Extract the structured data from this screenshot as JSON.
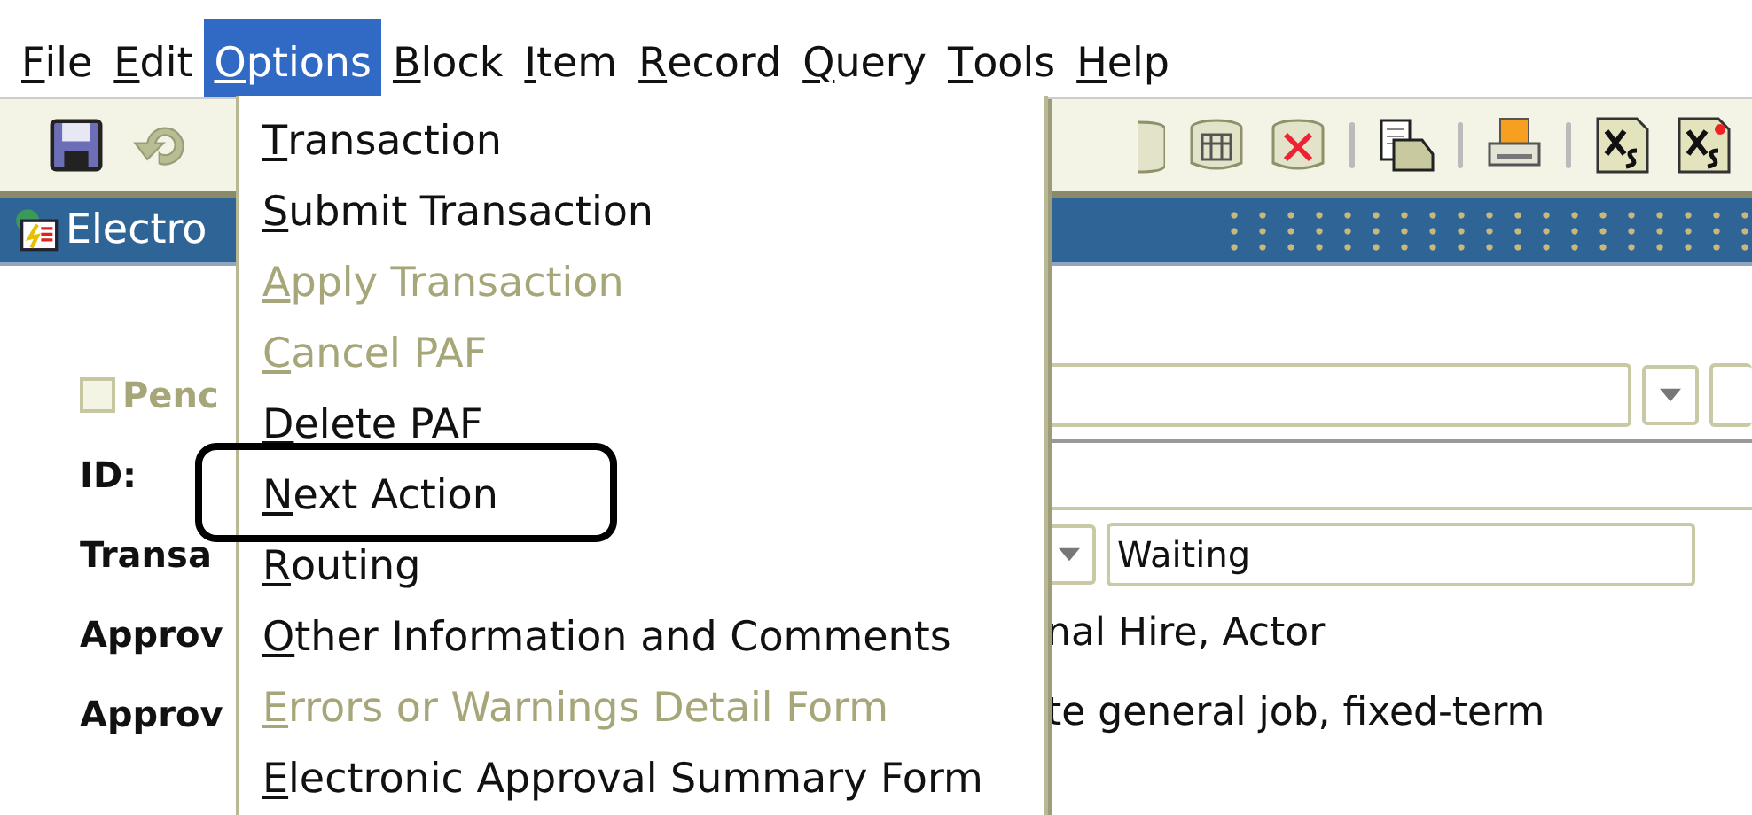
{
  "menu_bar": [
    {
      "label": "File",
      "selected": false
    },
    {
      "label": "Edit",
      "selected": false
    },
    {
      "label": "Options",
      "selected": true
    },
    {
      "label": "Block",
      "selected": false
    },
    {
      "label": "Item",
      "selected": false
    },
    {
      "label": "Record",
      "selected": false
    },
    {
      "label": "Query",
      "selected": false
    },
    {
      "label": "Tools",
      "selected": false
    },
    {
      "label": "Help",
      "selected": false
    }
  ],
  "title_bar": {
    "title": "Electro"
  },
  "options_menu": [
    {
      "label": "Transaction",
      "disabled": false,
      "outlined": false
    },
    {
      "label": "Submit Transaction",
      "disabled": false,
      "outlined": false
    },
    {
      "label": "Apply Transaction",
      "disabled": true,
      "outlined": false
    },
    {
      "label": "Cancel PAF",
      "disabled": true,
      "outlined": false
    },
    {
      "label": "Delete PAF",
      "disabled": false,
      "outlined": false
    },
    {
      "label": "Next Action",
      "disabled": false,
      "outlined": true
    },
    {
      "label": "Routing",
      "disabled": false,
      "outlined": false
    },
    {
      "label": "Other Information and Comments",
      "disabled": false,
      "outlined": false
    },
    {
      "label": "Errors or Warnings Detail Form",
      "disabled": true,
      "outlined": false
    },
    {
      "label": "Electronic Approval Summary Form",
      "disabled": false,
      "outlined": false
    }
  ],
  "form": {
    "pending": {
      "label": "Penc",
      "checked": false,
      "disabled": true
    },
    "rows": [
      {
        "kind": "label",
        "label": "ID:"
      },
      {
        "kind": "select",
        "label": "Transa",
        "value": "Waiting"
      },
      {
        "kind": "text",
        "label": "Approv",
        "value": "nal Hire, Actor"
      },
      {
        "kind": "text",
        "label": "Approv",
        "value": "te general job, fixed-term"
      }
    ]
  }
}
